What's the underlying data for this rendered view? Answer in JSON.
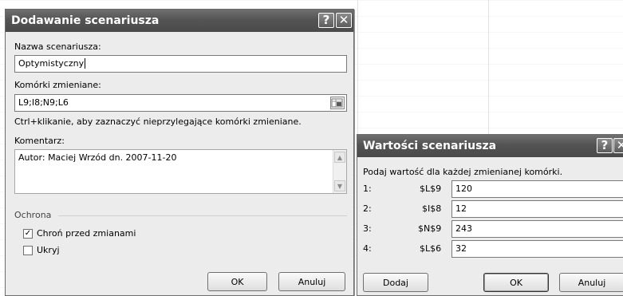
{
  "scenario_dialog": {
    "title": "Dodawanie scenariusza",
    "help_glyph": "?",
    "close_glyph": "✕",
    "name_label": "Nazwa scenariusza:",
    "name_value": "Optymistyczny",
    "cells_label": "Komórki zmieniane:",
    "cells_value": "L9;I8;N9;L6",
    "hint": "Ctrl+klikanie, aby zaznaczyć nieprzylegające komórki zmieniane.",
    "comment_label": "Komentarz:",
    "comment_value": "Autor: Maciej Wrzód dn. 2007-11-20",
    "protection_label": "Ochrona",
    "protect_label": "Chroń przed zmianami",
    "protect_checked": true,
    "hide_label": "Ukryj",
    "hide_checked": false,
    "ok_label": "OK",
    "cancel_label": "Anuluj"
  },
  "values_dialog": {
    "title": "Wartości scenariusza",
    "help_glyph": "?",
    "close_glyph": "✕",
    "instruction": "Podaj wartość dla każdej zmienianej komórki.",
    "rows": [
      {
        "index": "1:",
        "cell": "$L$9",
        "value": "120"
      },
      {
        "index": "2:",
        "cell": "$I$8",
        "value": "12"
      },
      {
        "index": "3:",
        "cell": "$N$9",
        "value": "243"
      },
      {
        "index": "4:",
        "cell": "$L$6",
        "value": "32"
      }
    ],
    "add_label": "Dodaj",
    "ok_label": "OK",
    "cancel_label": "Anuluj"
  }
}
